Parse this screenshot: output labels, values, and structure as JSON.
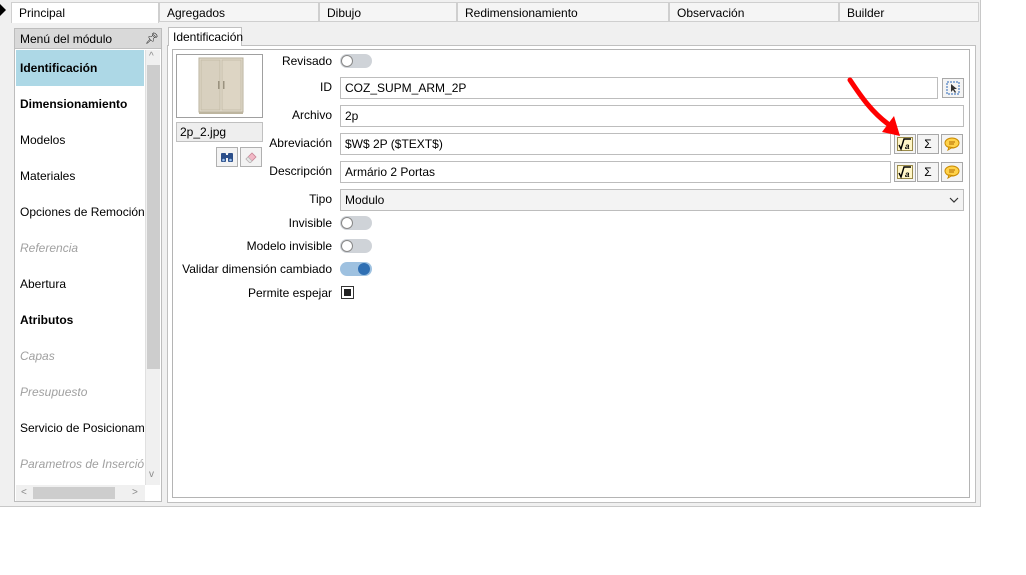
{
  "tabs": [
    "Principal",
    "Agregados",
    "Dibujo",
    "Redimensionamiento",
    "Observación",
    "Builder"
  ],
  "left_panel": {
    "title": "Menú del módulo",
    "items": [
      {
        "label": "Identificación",
        "style": "selected"
      },
      {
        "label": "Dimensionamiento",
        "style": "bold"
      },
      {
        "label": "Modelos",
        "style": "normal"
      },
      {
        "label": "Materiales",
        "style": "normal"
      },
      {
        "label": "Opciones de Remoción",
        "style": "normal"
      },
      {
        "label": "Referencia",
        "style": "disabled"
      },
      {
        "label": "Abertura",
        "style": "normal"
      },
      {
        "label": "Atributos",
        "style": "bold"
      },
      {
        "label": "Capas",
        "style": "disabled"
      },
      {
        "label": "Presupuesto",
        "style": "disabled"
      },
      {
        "label": "Servicio de Posicionamiento",
        "style": "normal"
      },
      {
        "label": "Parametros de Inserción",
        "style": "disabled"
      }
    ],
    "scroll_up": "^",
    "scroll_down": "v",
    "scroll_left": "<",
    "scroll_right": ">"
  },
  "subtab": "Identificación",
  "image": {
    "filename": "2p_2.jpg"
  },
  "form": {
    "revisado_label": "Revisado",
    "revisado_on": false,
    "id_label": "ID",
    "id_value": "COZ_SUPM_ARM_2P",
    "archivo_label": "Archivo",
    "archivo_value": "2p",
    "abreviacion_label": "Abreviación",
    "abreviacion_value": "$W$ 2P ($TEXT$)",
    "descripcion_label": "Descripción",
    "descripcion_value": "Armário 2 Portas",
    "tipo_label": "Tipo",
    "tipo_value": "Modulo",
    "invisible_label": "Invisible",
    "invisible_on": false,
    "modelo_invisible_label": "Modelo invisible",
    "modelo_invisible_on": false,
    "validar_label": "Validar dimensión cambiado",
    "validar_on": true,
    "espejar_label": "Permite espejar",
    "espejar_checked": true
  },
  "buttons": {
    "sigma": "Σ"
  },
  "colors": {
    "selection": "#add8e6",
    "annotation_arrow": "#ff0000",
    "toggle_on": "#2f6fb3"
  }
}
